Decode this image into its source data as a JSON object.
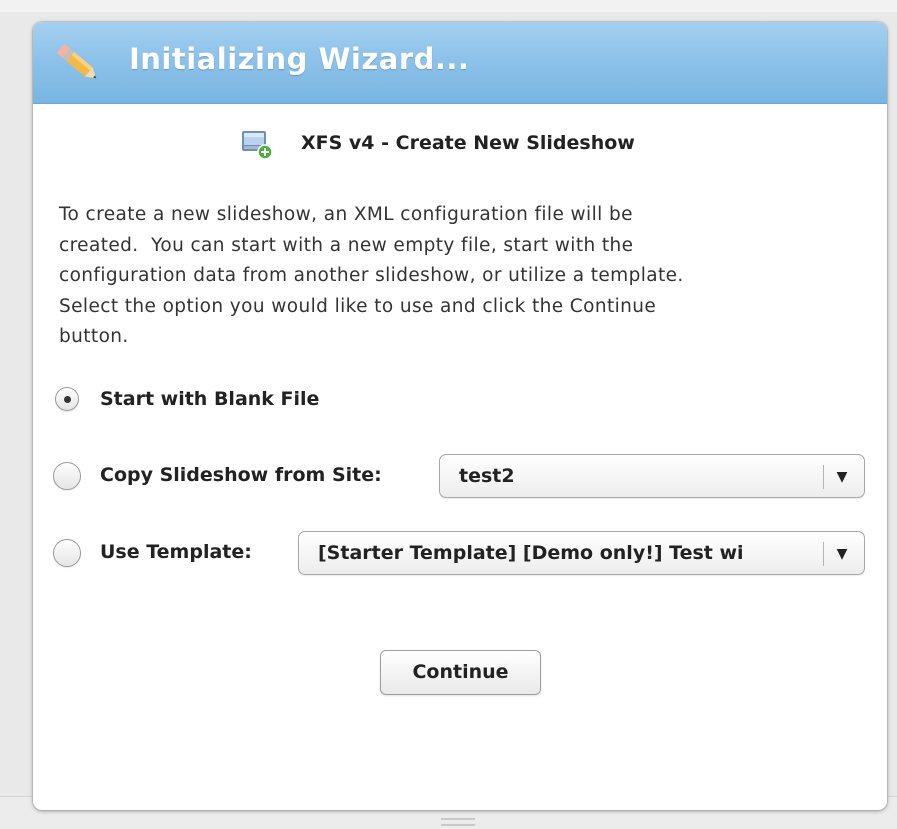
{
  "dialog": {
    "title": "Initializing Wizard...",
    "title_icon": "pencil-icon",
    "subtitle": "XFS v4 - Create New Slideshow",
    "subtitle_icon": "new-slideshow-icon",
    "description_lines": [
      "To create a new slideshow, an XML configuration file will be",
      "created.  You can start with a new empty file, start with the",
      "configuration data from another slideshow, or utilize a template.",
      "Select the option you would like to use and click the Continue",
      "button."
    ],
    "options": {
      "blank": {
        "label": "Start with Blank File",
        "selected": true
      },
      "copy": {
        "label": "Copy Slideshow from Site:",
        "selected": false,
        "select_value": "test2"
      },
      "template": {
        "label": "Use Template:",
        "selected": false,
        "select_value": "[Starter Template] [Demo only!] Test wi"
      }
    },
    "continue_label": "Continue"
  },
  "colors": {
    "titlebar_top": "#a5d0ef",
    "titlebar_bottom": "#79b5e2",
    "title_text": "#ffffff"
  }
}
